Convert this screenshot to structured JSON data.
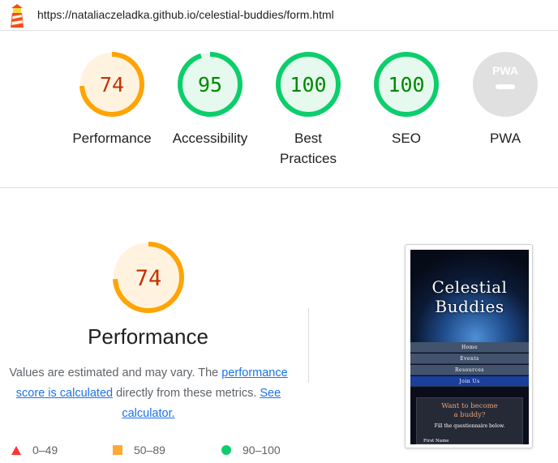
{
  "url": "https://nataliaczeladka.github.io/celestial-buddies/form.html",
  "colors": {
    "average": "#ffa400",
    "average_text": "#c33300",
    "average_bg": "#fff3e0",
    "pass": "#0cce6b",
    "pass_text": "#008800",
    "pass_bg": "#e6f9ee",
    "na": "#e0e0e0",
    "fail": "#ff3333"
  },
  "scores": [
    {
      "label": "Performance",
      "score": "74",
      "fraction": 0.74,
      "status": "average"
    },
    {
      "label": "Accessibility",
      "score": "95",
      "fraction": 0.95,
      "status": "pass"
    },
    {
      "label": "Best Practices",
      "score": "100",
      "fraction": 1.0,
      "status": "pass"
    },
    {
      "label": "SEO",
      "score": "100",
      "fraction": 1.0,
      "status": "pass"
    },
    {
      "label": "PWA",
      "score": "",
      "fraction": 0,
      "status": "na",
      "icon": "pwa-icon"
    }
  ],
  "performance": {
    "score": "74",
    "fraction": 0.74,
    "title": "Performance",
    "note_prefix": "Values are estimated and may vary. The",
    "note_link1": "performance score is calculated",
    "note_mid": "directly from these metrics.",
    "note_link2": "See calculator."
  },
  "legend": [
    {
      "range": "0–49",
      "icon": "triangle-fail-icon"
    },
    {
      "range": "50–89",
      "icon": "square-average-icon"
    },
    {
      "range": "90–100",
      "icon": "circle-pass-icon"
    }
  ],
  "screenshot": {
    "title_line1": "Celestial",
    "title_line2": "Buddies",
    "nav": [
      "Home",
      "Events",
      "Resources",
      "Join Us"
    ],
    "heading_line1": "Want to become",
    "heading_line2": "a buddy?",
    "subtext": "Fill the questionnaire below.",
    "field_label": "First Name"
  }
}
